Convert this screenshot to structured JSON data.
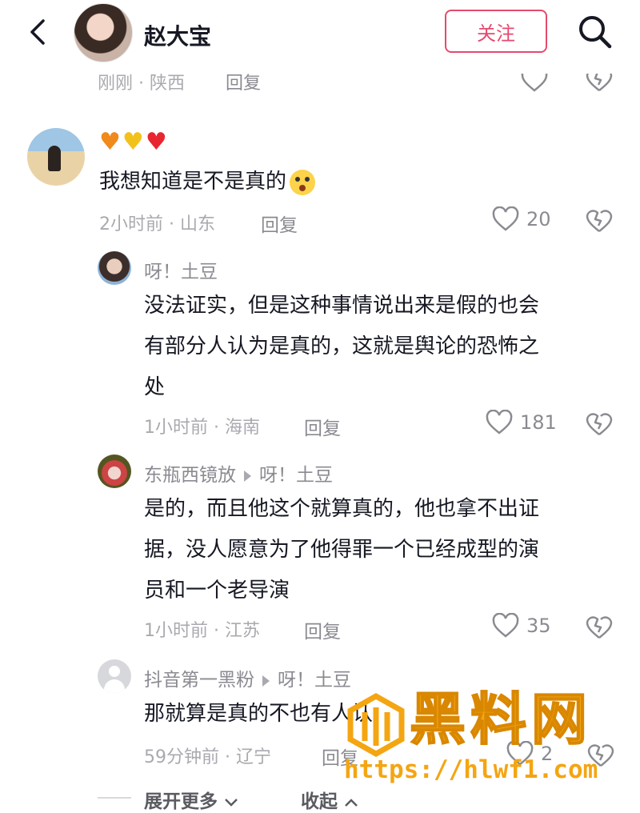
{
  "header": {
    "username": "赵大宝",
    "follow_label": "关注"
  },
  "top_partial": {
    "meta": "刚刚 · 陕西",
    "reply_label": "回复"
  },
  "comments": [
    {
      "emoji_line": [
        "orange-heart",
        "yellow-heart",
        "red-heart"
      ],
      "text": "我想知道是不是真的",
      "emoji_after_text": "surprised-face",
      "meta": "2小时前 · 山东",
      "reply_label": "回复",
      "likes": "20"
    },
    {
      "username": "呀！土豆",
      "text_lines": [
        "没法证实，但是这种事情说出来是假的也会",
        "有部分人认为是真的，这就是舆论的恐怖之",
        "处"
      ],
      "meta": "1小时前 · 海南",
      "reply_label": "回复",
      "likes": "181"
    },
    {
      "username": "东瓶西镜放",
      "reply_to": "呀！土豆",
      "text_lines": [
        "是的，而且他这个就算真的，他也拿不出证",
        "据，没人愿意为了他得罪一个已经成型的演",
        "员和一个老导演"
      ],
      "meta": "1小时前 · 江苏",
      "reply_label": "回复",
      "likes": "35"
    },
    {
      "username": "抖音第一黑粉",
      "reply_to": "呀！土豆",
      "text": "那就算是真的不也有人认",
      "meta": "59分钟前 · 辽宁",
      "reply_label": "回复",
      "likes": "2"
    }
  ],
  "footer": {
    "expand_label": "展开更多",
    "collapse_label": "收起"
  },
  "watermark": {
    "title": "黑料网",
    "url": "https://hlwf1.com"
  },
  "colors": {
    "accent": "#e54a6e",
    "muted": "#a9aab0",
    "watermark": "#f4a512"
  }
}
